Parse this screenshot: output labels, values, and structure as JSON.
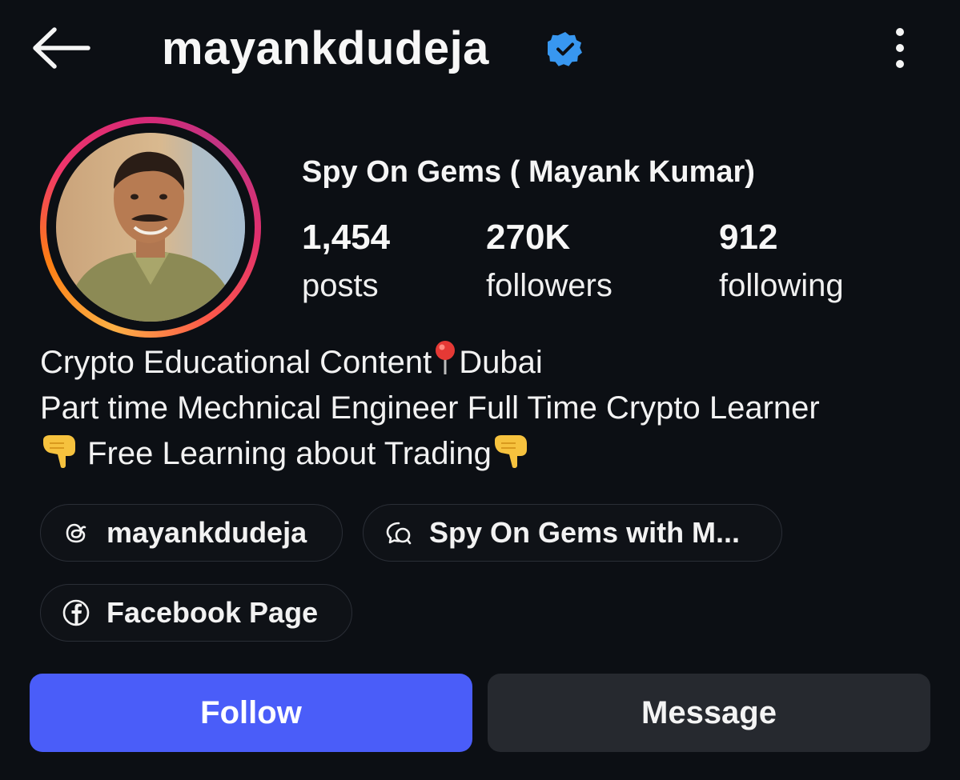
{
  "header": {
    "username": "mayankdudeja",
    "back_icon": "arrow-left-icon",
    "verified_icon": "verified-badge-icon",
    "more_icon": "more-vertical-icon"
  },
  "profile": {
    "display_name": "Spy On Gems ( Mayank Kumar)",
    "stats": [
      {
        "value": "1,454",
        "label": "posts"
      },
      {
        "value": "270K",
        "label": "followers"
      },
      {
        "value": "912",
        "label": "following"
      }
    ]
  },
  "bio": {
    "line1_before": "Crypto Educational Content",
    "line1_after": "Dubai",
    "line2": "Part time Mechnical Engineer Full Time Crypto Learner",
    "line3": " Free Learning about Trading"
  },
  "links": [
    {
      "label": "mayankdudeja",
      "icon": "threads-icon"
    },
    {
      "label": "Spy On Gems with M...",
      "icon": "channel-chat-icon"
    },
    {
      "label": "Facebook Page",
      "icon": "facebook-icon"
    }
  ],
  "actions": {
    "follow_label": "Follow",
    "message_label": "Message"
  },
  "colors": {
    "background": "#0c0f14",
    "follow_button": "#4a5df9",
    "message_button": "#26292f",
    "verified_badge": "#3897f0"
  }
}
